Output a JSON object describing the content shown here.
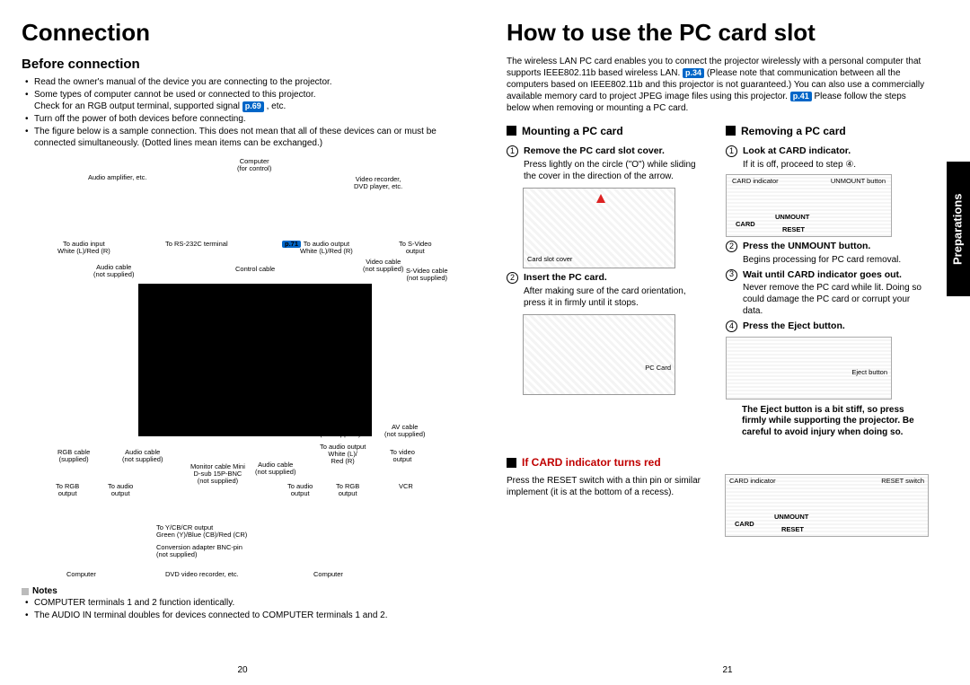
{
  "left": {
    "title": "Connection",
    "subtitle": "Before connection",
    "bullets": [
      "Read the owner's manual of the device you are connecting to the projector.",
      "Some types of computer cannot be used or connected to this projector.",
      "Check for an RGB output terminal, supported signal",
      ", etc.",
      "Turn off the power of both devices before connecting.",
      "The figure below is a sample connection. This does not mean that all of these devices can or must be connected simultaneously. (Dotted lines mean items can be exchanged.)"
    ],
    "pref1": "p.69",
    "diagram_labels": {
      "computer_for_control": "Computer\n(for control)",
      "audio_amp": "Audio amplifier, etc.",
      "video_rec": "Video recorder,\nDVD player, etc.",
      "to_audio_input": "To audio input\nWhite (L)/Red (R)",
      "to_rs232c": "To RS-232C terminal",
      "p71": "p.71",
      "to_audio_output": "To audio output\nWhite (L)/Red (R)",
      "to_svideo": "To S-Video\noutput",
      "audio_cable": "Audio cable\n(not supplied)",
      "control_cable": "Control cable",
      "video_cable": "Video cable\n(not supplied)",
      "svideo_cable": "S-Video cable\n(not supplied)",
      "rgb_cable_sup": "RGB cable\n(supplied)",
      "audio_cable2": "Audio cable\n(not supplied)",
      "rgb_cable_ns": "RGB cable\n(not supplied)",
      "monitor_cable": "Monitor cable Mini\nD-sub 15P-BNC\n(not supplied)",
      "audio_cable3": "Audio cable\n(not supplied)",
      "av_cable": "AV cable\n(not supplied)",
      "to_audio_out_wr": "To audio output\nWhite (L)/\nRed (R)",
      "to_video_out": "To video\noutput",
      "to_rgb_out": "To RGB\noutput",
      "to_audio_out": "To audio\noutput",
      "to_audio_out2": "To audio\noutput",
      "to_rgb_out2": "To RGB\noutput",
      "vcr": "VCR",
      "to_ycbcr": "To Y/CB/CR output\nGreen (Y)/Blue (CB)/Red (CR)",
      "conv_adapter": "Conversion adapter BNC-pin\n(not supplied)",
      "computer_bl": "Computer",
      "dvd_rec": "DVD video recorder, etc.",
      "computer_br": "Computer"
    },
    "notes_title": "Notes",
    "notes": [
      "COMPUTER terminals 1 and 2 function identically.",
      "The AUDIO IN terminal doubles for devices connected to COMPUTER terminals 1 and 2."
    ],
    "pageno": "20"
  },
  "right": {
    "title": "How to use the PC card slot",
    "intro_a": "The wireless LAN PC card enables you to connect the projector wirelessly with a personal computer that supports IEEE802.11b based wireless LAN.",
    "pref_p34": "p.34",
    "intro_b": "(Please note that communication between all the computers based on IEEE802.11b and this projector is not guaranteed.) You can also use a commercially available memory card to project JPEG image files using this projector.",
    "pref_p41": "p.41",
    "intro_c": "Please follow the steps below when removing or mounting a PC card.",
    "mount_title": "Mounting a PC card",
    "mount_steps": [
      {
        "n": "1",
        "title": "Remove the PC card slot cover.",
        "text": "Press lightly on the circle (\"O\") while sliding the cover in the direction of the arrow.",
        "label": "Card slot cover"
      },
      {
        "n": "2",
        "title": "Insert the PC card.",
        "text": "After making sure of the card orientation, press it in firmly until it stops.",
        "label": "PC Card"
      }
    ],
    "remove_title": "Removing a PC card",
    "remove_steps": [
      {
        "n": "1",
        "title": "Look at CARD indicator.",
        "text": "If it is off, proceed to step ④.",
        "labels": [
          "CARD indicator",
          "UNMOUNT button",
          "CARD",
          "UNMOUNT",
          "RESET"
        ]
      },
      {
        "n": "2",
        "title": "Press the UNMOUNT button.",
        "text": "Begins processing for PC card removal."
      },
      {
        "n": "3",
        "title": "Wait until CARD indicator goes out.",
        "text": "Never remove the PC card while lit. Doing so could damage the PC card or corrupt your data."
      },
      {
        "n": "4",
        "title": "Press the Eject button.",
        "text": "",
        "label": "Eject button"
      }
    ],
    "eject_note": "The Eject button is a bit stiff, so press firmly while supporting the projector. Be careful to avoid injury when doing so.",
    "red_title": "If CARD indicator turns red",
    "red_text": "Press the RESET switch with a thin pin or similar implement (it is at the bottom of a recess).",
    "red_labels": [
      "CARD indicator",
      "RESET switch",
      "CARD",
      "UNMOUNT",
      "RESET"
    ],
    "tab": "Preparations",
    "pageno": "21"
  }
}
